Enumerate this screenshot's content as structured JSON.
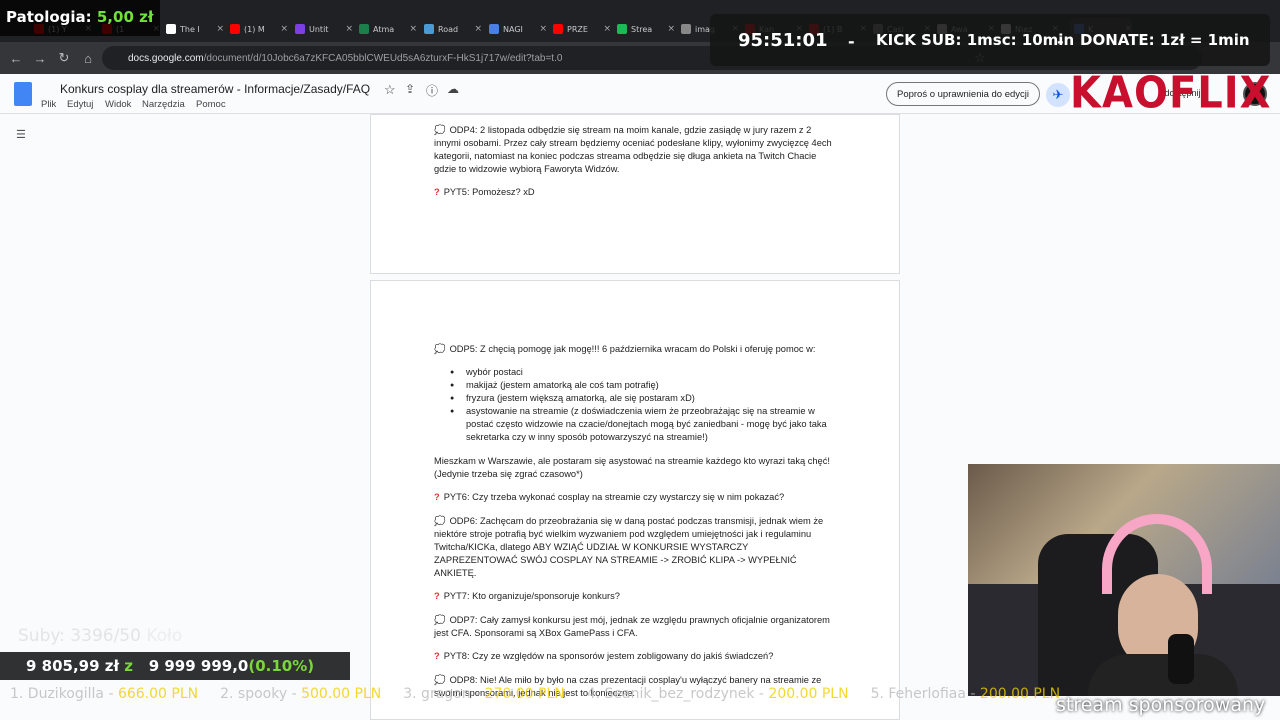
{
  "browser": {
    "tabs": [
      {
        "label": "(1) Y",
        "color": "#f00"
      },
      {
        "label": "(1",
        "color": "#f00"
      },
      {
        "label": "The I",
        "color": "#fff"
      },
      {
        "label": "(1) M",
        "color": "#f00"
      },
      {
        "label": "Untit",
        "color": "#7b3fe4"
      },
      {
        "label": "Atma",
        "color": "#1a7f4b"
      },
      {
        "label": "Road",
        "color": "#4a9ad6"
      },
      {
        "label": "NAGI",
        "color": "#4a7fe4"
      },
      {
        "label": "PRZE",
        "color": "#f00"
      },
      {
        "label": "Strea",
        "color": "#1db954"
      },
      {
        "label": "imag",
        "color": "#888"
      },
      {
        "label": "Kan",
        "color": "#f00"
      },
      {
        "label": "(1) B",
        "color": "#f00"
      },
      {
        "label": "Casi",
        "color": "#888"
      },
      {
        "label": "Awa",
        "color": "#ccc"
      },
      {
        "label": "Niez",
        "color": "#fff"
      },
      {
        "label": "K",
        "color": "#4a7fe4"
      }
    ],
    "url_host": "docs.google.com",
    "url_path": "/document/d/10Jobc6a7zKFCA05bblCWEUd5sA6zturxF-HkS1j717w/edit?tab=t.0"
  },
  "docs": {
    "title": "Konkurs cosplay dla streamerów - Informacje/Zasady/FAQ",
    "menus": [
      "Plik",
      "Edytuj",
      "Widok",
      "Narzędzia",
      "Pomoc"
    ],
    "permission_button": "Poproś o uprawnienia do edycji",
    "share_partial": "Udostępnij"
  },
  "content": {
    "odp4": "ODP4: 2 listopada odbędzie się stream na moim kanale, gdzie zasiądę w jury razem z 2 innymi osobami. Przez cały stream będziemy oceniać podesłane klipy, wyłonimy zwycięzcę 4ech kategorii, natomiast na koniec podczas streama odbędzie się długa ankieta na Twitch Chacie gdzie to widzowie wybiorą Faworyta Widzów.",
    "pyt5": "PYT5: Pomożesz? xD",
    "odp5": "ODP5: Z chęcią pomogę jak mogę!!! 6 października wracam do Polski i oferuję pomoc w:",
    "odp5_list": [
      "wybór postaci",
      "makijaż (jestem amatorką ale coś tam potrafię)",
      "fryzura (jestem większą amatorką, ale się postaram xD)",
      "asystowanie na streamie (z doświadczenia wiem że przeobrażając się na streamie w postać często widzowie na czacie/donejtach mogą być zaniedbani - mogę być jako taka sekretarka czy w inny sposób potowarzyszyć na streamie!)"
    ],
    "warsaw": "Mieszkam w Warszawie, ale postaram się asystować na streamie każdego kto wyrazi taką chęć! (Jedynie trzeba się zgrać czasowo*)",
    "pyt6": "PYT6: Czy trzeba wykonać cosplay na streamie czy wystarczy się w nim pokazać?",
    "odp6": "ODP6: Zachęcam do przeobrażania się w daną postać podczas transmisji, jednak wiem że niektóre stroje potrafią być wielkim wyzwaniem pod względem umiejętności jak i regulaminu Twitcha/KICKa, dlatego ABY WZIĄĆ UDZIAŁ W KONKURSIE WYSTARCZY ZAPREZENTOWAĆ SWÓJ COSPLAY NA STREAMIE -> ZROBIĆ KLIPA -> WYPEŁNIĆ ANKIETĘ.",
    "pyt7": "PYT7: Kto organizuje/sponsoruje konkurs?",
    "odp7": "ODP7: Cały zamysł konkursu jest mój, jednak ze względu prawnych oficjalnie organizatorem jest CFA. Sponsorami są XBox GamePass i CFA.",
    "pyt8": "PYT8: Czy ze względów na sponsorów jestem zobligowany do jakiś świadczeń?",
    "odp8": "ODP8: Nie! Ale miło by było na czas prezentacji cosplay'u wyłączyć banery na streamie ze swoimi sponsorami, jednak nie jest to konieczne."
  },
  "overlay": {
    "patologia_label": "Patologia:",
    "patologia_value": "5,00 zł",
    "timer": "95:51:01",
    "kick_sub": "KICK SUB: 1msc: 10min",
    "donate": "DONATE: 1zł = 1min",
    "brand": "KAOFLIX",
    "subs": "Suby: 3396/50",
    "subs_ghost": "Koło",
    "money_current": "9 805,99 zł",
    "money_sep": "z",
    "money_goal": "9 999 999,0",
    "money_pct": "(0.10%)",
    "ticker": [
      {
        "name": "1. Duzikogilla -",
        "value": "666.00 PLN"
      },
      {
        "name": "2. spooky -",
        "value": "500.00 PLN"
      },
      {
        "name": "3. gragon -",
        "value": "270.00 PLN"
      },
      {
        "name": "4. Seanik_bez_rodzynek -",
        "value": "200.00 PLN"
      },
      {
        "name": "5. Feherlofiaa -",
        "value": "200.00 PLN"
      }
    ],
    "sponsor": "stream sponsorowany"
  }
}
